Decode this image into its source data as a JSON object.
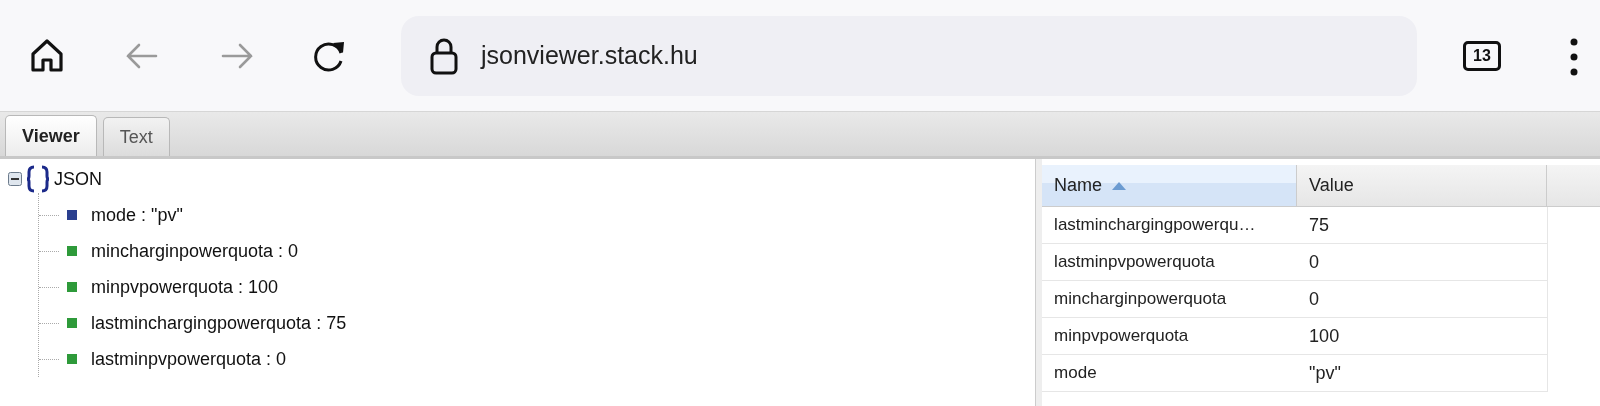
{
  "toolbar": {
    "back_disabled": true,
    "forward_disabled": true,
    "address": "jsonviewer.stack.hu",
    "tab_count": "13"
  },
  "tabs": [
    {
      "label": "Viewer",
      "selected": true
    },
    {
      "label": "Text",
      "selected": false
    }
  ],
  "tree": {
    "label": "JSON",
    "expanded": true,
    "children": [
      {
        "label": "mode : \"pv\"",
        "color": "#2a3f8f"
      },
      {
        "label": "mincharginpowerquota : 0",
        "color": "#2e9a3a"
      },
      {
        "label": "minpvpowerquota : 100",
        "color": "#2e9a3a"
      },
      {
        "label": "lastminchargingpowerquota : 75",
        "color": "#2e9a3a"
      },
      {
        "label": "lastminpvpowerquota : 0",
        "color": "#2e9a3a"
      }
    ]
  },
  "grid": {
    "columns": [
      {
        "label": "Name",
        "sorted": true
      },
      {
        "label": "Value",
        "sorted": false
      }
    ],
    "rows": [
      [
        "lastminchargingpowerqu…",
        "75"
      ],
      [
        "lastminpvpowerquota",
        "0"
      ],
      [
        "mincharginpowerquota",
        "0"
      ],
      [
        "minpvpowerquota",
        "100"
      ],
      [
        "mode",
        "\"pv\""
      ]
    ]
  }
}
